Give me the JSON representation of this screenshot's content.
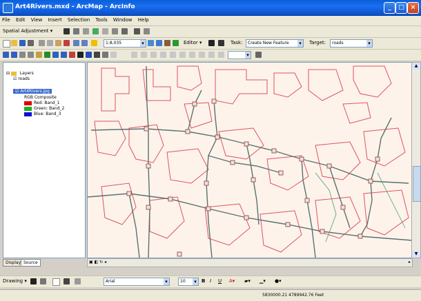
{
  "window": {
    "title": "Art4Rivers.mxd - ArcMap - ArcInfo",
    "minimize": "_",
    "maximize": "□",
    "close": "×"
  },
  "menu": [
    "File",
    "Edit",
    "View",
    "Insert",
    "Selection",
    "Tools",
    "Window",
    "Help"
  ],
  "toolbar1": {
    "spatial_adjustment": "Spatial Adjustment ▾"
  },
  "toolbar2": {
    "scale": "1:8,035",
    "editor": "Editor ▾",
    "task_label": "Task:",
    "task_value": "Create New Feature",
    "target_label": "Target:",
    "target_value": "roads"
  },
  "toc": {
    "layers_label": "Layers",
    "roads_label": "roads",
    "raster_label": "Art4Rivers.jpg",
    "rgb_label": "RGB Composite",
    "bands": [
      {
        "label": "Red:   Band_1",
        "color": "#e00000"
      },
      {
        "label": "Green: Band_2",
        "color": "#20b020"
      },
      {
        "label": "Blue:  Band_3",
        "color": "#1010d0"
      }
    ],
    "tab_display": "Display",
    "tab_source": "Source"
  },
  "drawing": {
    "label": "Drawing ▾",
    "font": "Arial",
    "size": "10"
  },
  "status": {
    "coords": "5830000.21  4789942.76 Feet"
  },
  "colors": {
    "title_bar": "#0a5fd8",
    "map_background": "#fdf3ea",
    "road_line": "#5a7070",
    "contour_line": "#e05060",
    "vertex": "#8a5050"
  }
}
